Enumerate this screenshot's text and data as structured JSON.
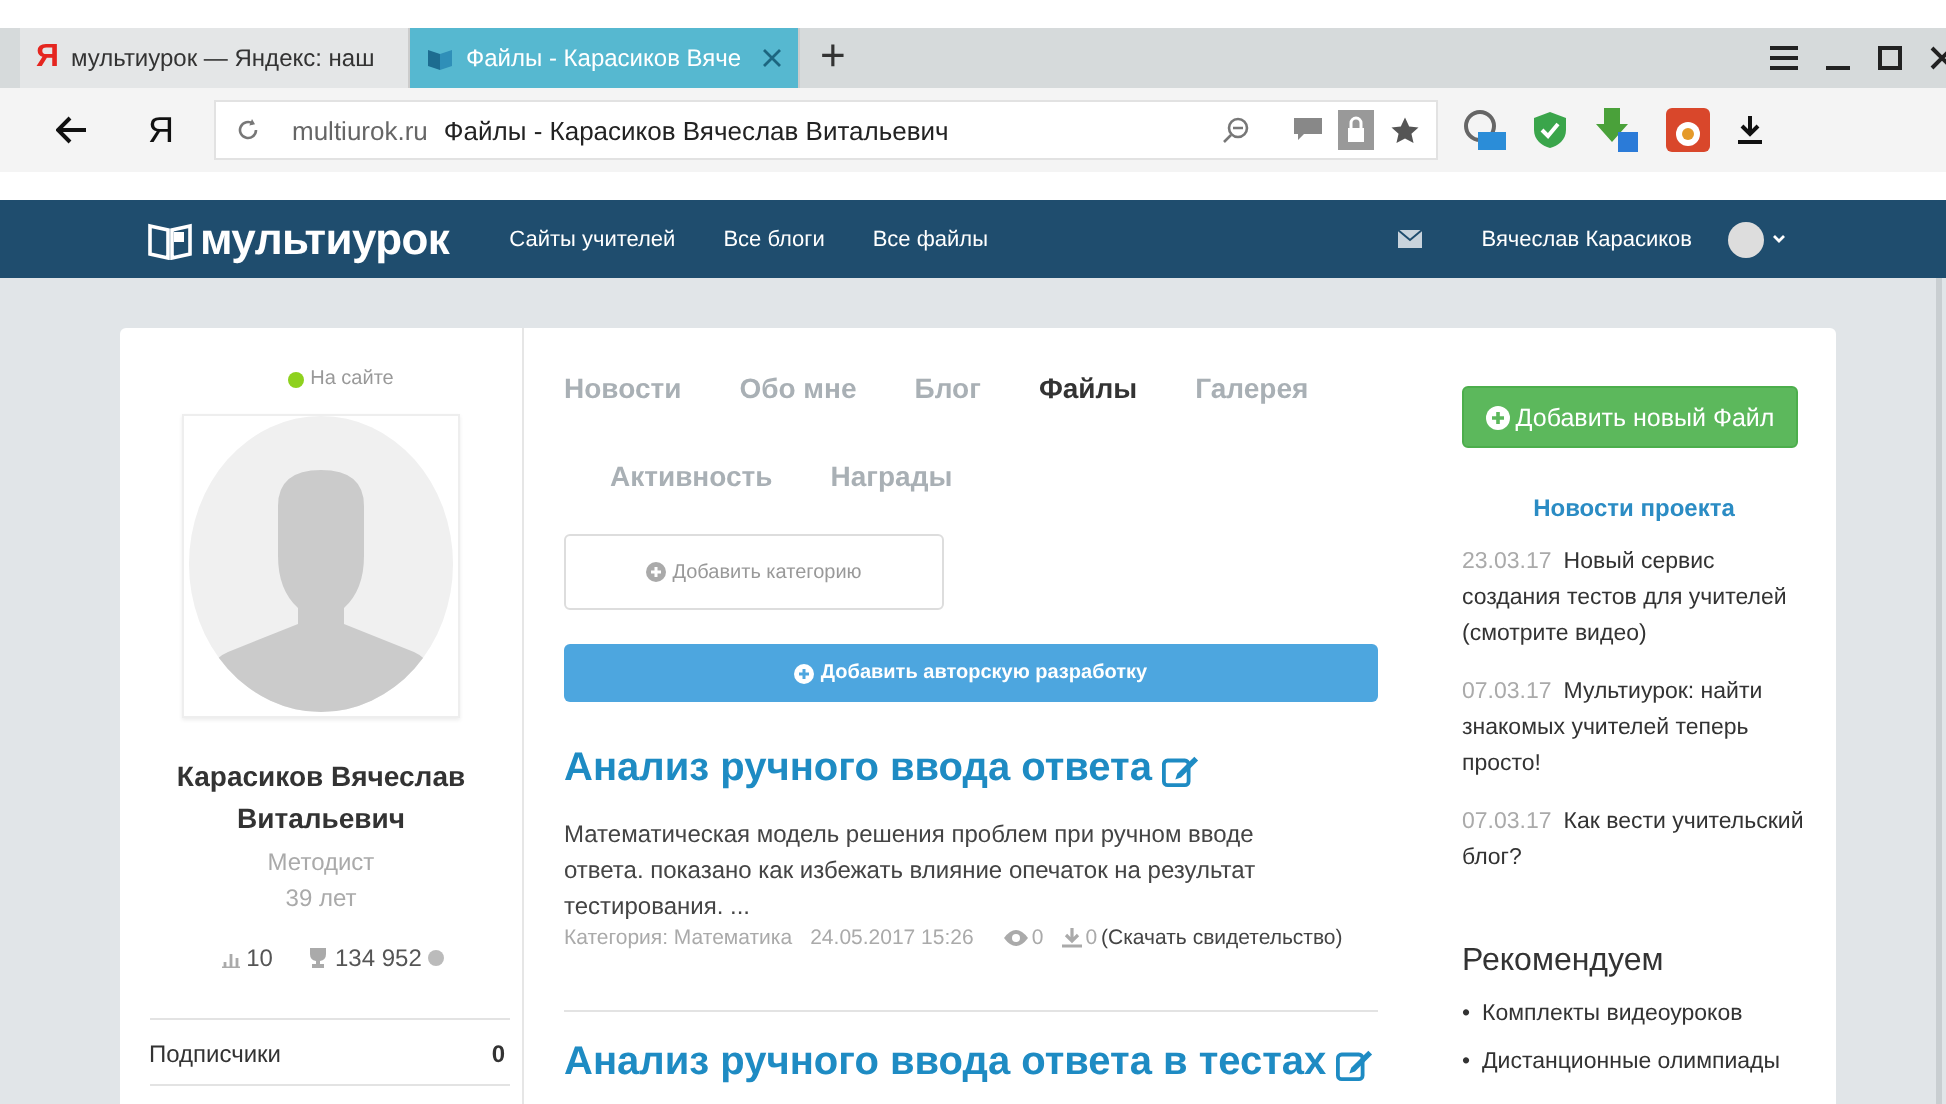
{
  "browser": {
    "tabs": [
      {
        "logo": "Я",
        "title": "мультиурок — Яндекс: наш",
        "selected": false
      },
      {
        "title": "Файлы - Карасиков Вяче",
        "selected": true
      }
    ],
    "new_tab": "+",
    "logo": "Я",
    "address": {
      "domain": "multiurok.ru",
      "page_title": "Файлы - Карасиков Вячеслав Витальевич"
    }
  },
  "site_nav": {
    "logo": "мультиурок",
    "links": [
      "Сайты учителей",
      "Все блоги",
      "Все файлы"
    ],
    "user": "Вячеслав Карасиков"
  },
  "profile": {
    "status": "На сайте",
    "online": true,
    "name": "Карасиков Вячеслав Витальевич",
    "role": "Методист",
    "age": "39 лет",
    "rating": "10",
    "points": "134 952",
    "counters": [
      {
        "label": "Подписчики",
        "value": "0"
      }
    ]
  },
  "profile_tabs": [
    [
      {
        "label": "Новости",
        "selected": false
      },
      {
        "label": "Обо мне",
        "selected": false
      },
      {
        "label": "Блог",
        "selected": false
      },
      {
        "label": "Файлы",
        "selected": true
      },
      {
        "label": "Галерея",
        "selected": false
      }
    ],
    [
      {
        "label": "Активность",
        "selected": false
      },
      {
        "label": "Награды",
        "selected": false
      }
    ]
  ],
  "add_category_button": "Добавить категорию",
  "add_work_button": "Добавить авторскую разработку",
  "articles": [
    {
      "title": "Анализ ручного ввода ответа",
      "description": "Математическая модель решения проблем при ручном вводе ответа. показано как избежать влияние опечаток на результат тестирования. ...",
      "category": "Категория: Математика",
      "date": "24.05.2017 15:26",
      "views": "0",
      "downloads": "0",
      "certificate_link": "(Скачать свидетельство)"
    },
    {
      "title": "Анализ ручного ввода ответа в тестах"
    }
  ],
  "sidebar": {
    "add_file_button": "Добавить новый Файл",
    "news_title": "Новости проекта",
    "news": [
      {
        "date": "23.03.17",
        "title": "Новый сервис создания тестов для учителей (смотрите видео)"
      },
      {
        "date": "07.03.17",
        "title": "Мультиурок: найти знакомых учителей теперь просто!"
      },
      {
        "date": "07.03.17",
        "title": "Как вести учительский блог?"
      }
    ],
    "recommend_title": "Рекомендуем",
    "recommend": [
      {
        "bullet": "•",
        "label": "Комплекты видеоуроков"
      },
      {
        "bullet": "•",
        "label": "Дистанционные олимпиады"
      }
    ]
  }
}
